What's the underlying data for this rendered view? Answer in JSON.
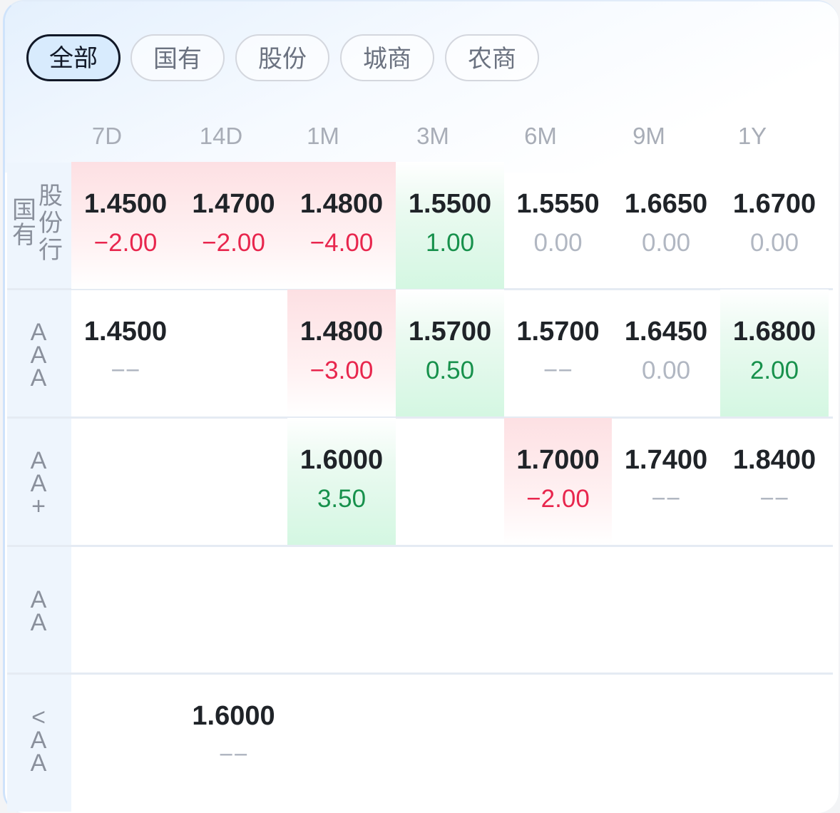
{
  "filter_tabs": [
    {
      "label": "全部",
      "active": true
    },
    {
      "label": "国有",
      "active": false
    },
    {
      "label": "股份",
      "active": false
    },
    {
      "label": "城商",
      "active": false
    },
    {
      "label": "农商",
      "active": false
    }
  ],
  "terms": [
    "7D",
    "14D",
    "1M",
    "3M",
    "6M",
    "9M",
    "1Y"
  ],
  "rows": [
    {
      "label_left": [
        "国",
        "有"
      ],
      "label_right": [
        "股",
        "份",
        "行"
      ],
      "cells": [
        {
          "rate": "1.4500",
          "change": "−2.00",
          "trend": "down",
          "highlight": "red"
        },
        {
          "rate": "1.4700",
          "change": "−2.00",
          "trend": "down",
          "highlight": "red"
        },
        {
          "rate": "1.4800",
          "change": "−4.00",
          "trend": "down",
          "highlight": "red"
        },
        {
          "rate": "1.5500",
          "change": "1.00",
          "trend": "up",
          "highlight": "green"
        },
        {
          "rate": "1.5550",
          "change": "0.00",
          "trend": "flat",
          "highlight": "none"
        },
        {
          "rate": "1.6650",
          "change": "0.00",
          "trend": "flat",
          "highlight": "none"
        },
        {
          "rate": "1.6700",
          "change": "0.00",
          "trend": "flat",
          "highlight": "none"
        }
      ]
    },
    {
      "label": [
        "A",
        "A",
        "A"
      ],
      "cells": [
        {
          "rate": "1.4500",
          "change": "−−",
          "trend": "flat",
          "highlight": "none"
        },
        null,
        {
          "rate": "1.4800",
          "change": "−3.00",
          "trend": "down",
          "highlight": "red"
        },
        {
          "rate": "1.5700",
          "change": "0.50",
          "trend": "up",
          "highlight": "green"
        },
        {
          "rate": "1.5700",
          "change": "−−",
          "trend": "flat",
          "highlight": "none"
        },
        {
          "rate": "1.6450",
          "change": "0.00",
          "trend": "flat",
          "highlight": "none"
        },
        {
          "rate": "1.6800",
          "change": "2.00",
          "trend": "up",
          "highlight": "green"
        }
      ]
    },
    {
      "label": [
        "A",
        "A",
        "+"
      ],
      "cells": [
        null,
        null,
        {
          "rate": "1.6000",
          "change": "3.50",
          "trend": "up",
          "highlight": "green"
        },
        null,
        {
          "rate": "1.7000",
          "change": "−2.00",
          "trend": "down",
          "highlight": "red"
        },
        {
          "rate": "1.7400",
          "change": "−−",
          "trend": "flat",
          "highlight": "none"
        },
        {
          "rate": "1.8400",
          "change": "−−",
          "trend": "flat",
          "highlight": "none"
        }
      ]
    },
    {
      "label": [
        "A",
        "A"
      ],
      "cells": [
        null,
        null,
        null,
        null,
        null,
        null,
        null
      ]
    },
    {
      "label": [
        "<",
        "A",
        "A"
      ],
      "cells": [
        null,
        {
          "rate": "1.6000",
          "change": "−−",
          "trend": "flat",
          "highlight": "none"
        },
        null,
        null,
        null,
        null,
        null
      ]
    }
  ],
  "colors": {
    "down": "#e8264d",
    "up": "#17914c",
    "flat": "#b1b7c2",
    "active_tab_bg": "#d8ebfd"
  }
}
